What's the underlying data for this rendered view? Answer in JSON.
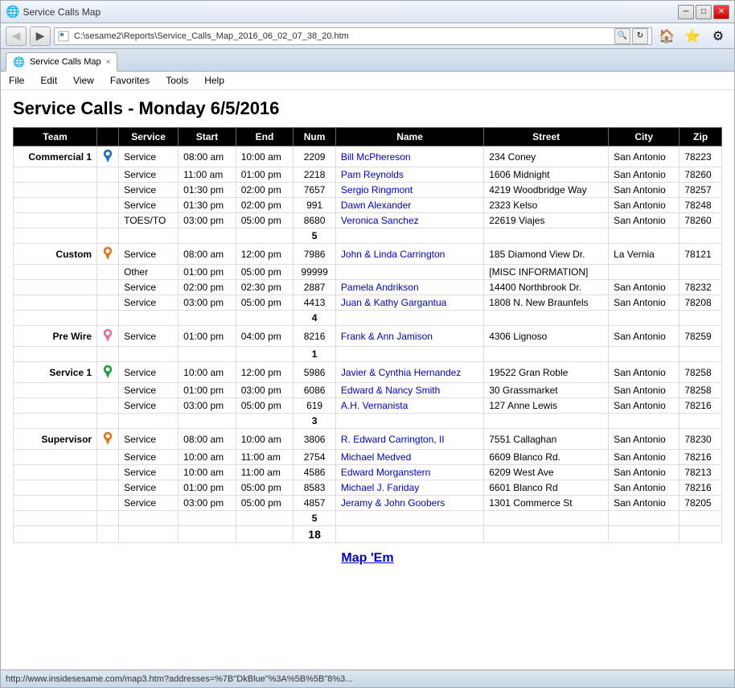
{
  "browser": {
    "title": "Service Calls Map",
    "address": "C:\\sesame2\\Reports\\Service_Calls_Map_2016_06_02_07_38_20.htm",
    "tab_label": "Service Calls Map",
    "tab_close": "×",
    "status_bar": "http://www.insidesesame.com/map3.htm?addresses=%7B\"DkBlue\"%3A%5B%5B\"8%3..."
  },
  "menu": {
    "items": [
      "File",
      "Edit",
      "View",
      "Favorites",
      "Tools",
      "Help"
    ]
  },
  "page": {
    "title": "Service Calls - Monday 6/5/2016",
    "map_link": "Map 'Em"
  },
  "table": {
    "headers": [
      "Team",
      "",
      "Service",
      "Start",
      "End",
      "Num",
      "Name",
      "Street",
      "City",
      "Zip"
    ],
    "groups": [
      {
        "team": "Commercial 1",
        "pin_color": "blue",
        "rows": [
          {
            "service": "Service",
            "start": "08:00 am",
            "end": "10:00 am",
            "num": "2209",
            "name": "Bill McPhereson",
            "street": "234 Coney",
            "city": "San Antonio",
            "zip": "78223"
          },
          {
            "service": "Service",
            "start": "11:00 am",
            "end": "01:00 pm",
            "num": "2218",
            "name": "Pam Reynolds",
            "street": "1606 Midnight",
            "city": "San Antonio",
            "zip": "78260"
          },
          {
            "service": "Service",
            "start": "01:30 pm",
            "end": "02:00 pm",
            "num": "7657",
            "name": "Sergio Ringmont",
            "street": "4219 Woodbridge Way",
            "city": "San Antonio",
            "zip": "78257"
          },
          {
            "service": "Service",
            "start": "01:30 pm",
            "end": "02:00 pm",
            "num": "991",
            "name": "Dawn Alexander",
            "street": "2323 Kelso",
            "city": "San Antonio",
            "zip": "78248"
          },
          {
            "service": "TOES/TO",
            "start": "03:00 pm",
            "end": "05:00 pm",
            "num": "8680",
            "name": "Veronica Sanchez",
            "street": "22619 Viajes",
            "city": "San Antonio",
            "zip": "78260"
          }
        ],
        "count": "5"
      },
      {
        "team": "Custom",
        "pin_color": "orange",
        "rows": [
          {
            "service": "Service",
            "start": "08:00 am",
            "end": "12:00 pm",
            "num": "7986",
            "name": "John & Linda Carrington",
            "street": "185 Diamond View Dr.",
            "city": "La Vernia",
            "zip": "78121"
          },
          {
            "service": "Other",
            "start": "01:00 pm",
            "end": "05:00 pm",
            "num": "99999",
            "name": "",
            "street": "[MISC INFORMATION]",
            "city": "",
            "zip": ""
          },
          {
            "service": "Service",
            "start": "02:00 pm",
            "end": "02:30 pm",
            "num": "2887",
            "name": "Pamela Andrikson",
            "street": "14400 Northbrook Dr.",
            "city": "San Antonio",
            "zip": "78232"
          },
          {
            "service": "Service",
            "start": "03:00 pm",
            "end": "05:00 pm",
            "num": "4413",
            "name": "Juan & Kathy Gargantua",
            "street": "1808 N. New Braunfels",
            "city": "San Antonio",
            "zip": "78208"
          }
        ],
        "count": "4"
      },
      {
        "team": "Pre Wire",
        "pin_color": "pink",
        "rows": [
          {
            "service": "Service",
            "start": "01:00 pm",
            "end": "04:00 pm",
            "num": "8216",
            "name": "Frank & Ann Jamison",
            "street": "4306 Lignoso",
            "city": "San Antonio",
            "zip": "78259"
          }
        ],
        "count": "1"
      },
      {
        "team": "Service 1",
        "pin_color": "green",
        "rows": [
          {
            "service": "Service",
            "start": "10:00 am",
            "end": "12:00 pm",
            "num": "5986",
            "name": "Javier & Cynthia Hernandez",
            "street": "19522 Gran Roble",
            "city": "San Antonio",
            "zip": "78258"
          },
          {
            "service": "Service",
            "start": "01:00 pm",
            "end": "03:00 pm",
            "num": "6086",
            "name": "Edward & Nancy Smith",
            "street": "30 Grassmarket",
            "city": "San Antonio",
            "zip": "78258"
          },
          {
            "service": "Service",
            "start": "03:00 pm",
            "end": "05:00 pm",
            "num": "619",
            "name": "A.H. Vernanista",
            "street": "127 Anne Lewis",
            "city": "San Antonio",
            "zip": "78216"
          }
        ],
        "count": "3"
      },
      {
        "team": "Supervisor",
        "pin_color": "orange",
        "rows": [
          {
            "service": "Service",
            "start": "08:00 am",
            "end": "10:00 am",
            "num": "3806",
            "name": "R. Edward Carrington, II",
            "street": "7551 Callaghan",
            "city": "San Antonio",
            "zip": "78230"
          },
          {
            "service": "Service",
            "start": "10:00 am",
            "end": "11:00 am",
            "num": "2754",
            "name": "Michael Medved",
            "street": "6609 Blanco Rd.",
            "city": "San Antonio",
            "zip": "78216"
          },
          {
            "service": "Service",
            "start": "10:00 am",
            "end": "11:00 am",
            "num": "4586",
            "name": "Edward Morganstern",
            "street": "6209 West Ave",
            "city": "San Antonio",
            "zip": "78213"
          },
          {
            "service": "Service",
            "start": "01:00 pm",
            "end": "05:00 pm",
            "num": "8583",
            "name": "Michael J. Fariday",
            "street": "6601 Blanco Rd",
            "city": "San Antonio",
            "zip": "78216"
          },
          {
            "service": "Service",
            "start": "03:00 pm",
            "end": "05:00 pm",
            "num": "4857",
            "name": "Jeramy & John Goobers",
            "street": "1301 Commerce St",
            "city": "San Antonio",
            "zip": "78205"
          }
        ],
        "count": "5"
      }
    ],
    "total": "18"
  }
}
